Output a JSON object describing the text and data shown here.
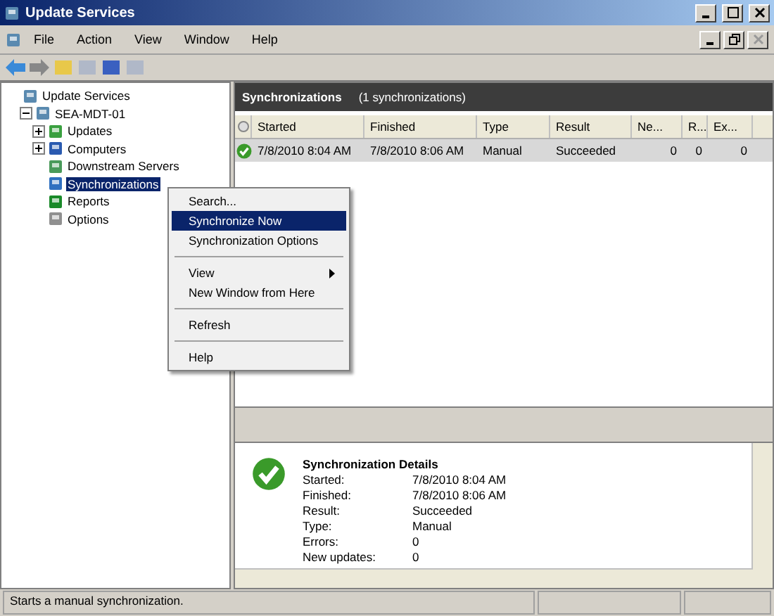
{
  "window": {
    "title": "Update Services"
  },
  "menu": [
    "File",
    "Action",
    "View",
    "Window",
    "Help"
  ],
  "tree": [
    {
      "label": "Update Services",
      "selected": false,
      "children": [
        {
          "label": "SEA-MDT-01",
          "expanded": true,
          "selected": false,
          "children": [
            {
              "label": "Updates",
              "expanded": false,
              "selected": false
            },
            {
              "label": "Computers",
              "expanded": false,
              "selected": false
            },
            {
              "label": "Downstream Servers",
              "selected": false
            },
            {
              "label": "Synchronizations",
              "selected": true
            },
            {
              "label": "Reports",
              "selected": false
            },
            {
              "label": "Options",
              "selected": false
            }
          ]
        }
      ]
    }
  ],
  "context_menu": [
    {
      "kind": "item",
      "label": "Search...",
      "selected": false
    },
    {
      "kind": "item",
      "label": "Synchronize Now",
      "selected": true
    },
    {
      "kind": "item",
      "label": "Synchronization Options",
      "selected": false
    },
    {
      "kind": "separator"
    },
    {
      "kind": "submenu",
      "label": "View",
      "selected": false
    },
    {
      "kind": "item",
      "label": "New Window from Here",
      "selected": false
    },
    {
      "kind": "separator"
    },
    {
      "kind": "item",
      "label": "Refresh",
      "selected": false
    },
    {
      "kind": "separator"
    },
    {
      "kind": "item",
      "label": "Help",
      "selected": false
    }
  ],
  "pane": {
    "title": "Synchronizations",
    "count": "(1 synchronizations)"
  },
  "table": {
    "columns": [
      "Started",
      "Finished",
      "Type",
      "Result",
      "Ne...",
      "R...",
      "Ex..."
    ],
    "rows": [
      {
        "selected": true,
        "cells": [
          "7/8/2010 8:04 AM",
          "7/8/2010 8:06 AM",
          "Manual",
          "Succeeded",
          "0",
          "0",
          "0"
        ]
      }
    ]
  },
  "details": {
    "title": "Synchronization Details",
    "fields": [
      {
        "label": "Started:",
        "value": "7/8/2010 8:04 AM"
      },
      {
        "label": "Finished:",
        "value": "7/8/2010 8:06 AM"
      },
      {
        "label": "Result:",
        "value": "Succeeded"
      },
      {
        "label": "Type:",
        "value": "Manual"
      },
      {
        "label": "Errors:",
        "value": "0"
      },
      {
        "label": "New updates:",
        "value": "0"
      }
    ]
  },
  "status_bar": "Starts a manual synchronization."
}
